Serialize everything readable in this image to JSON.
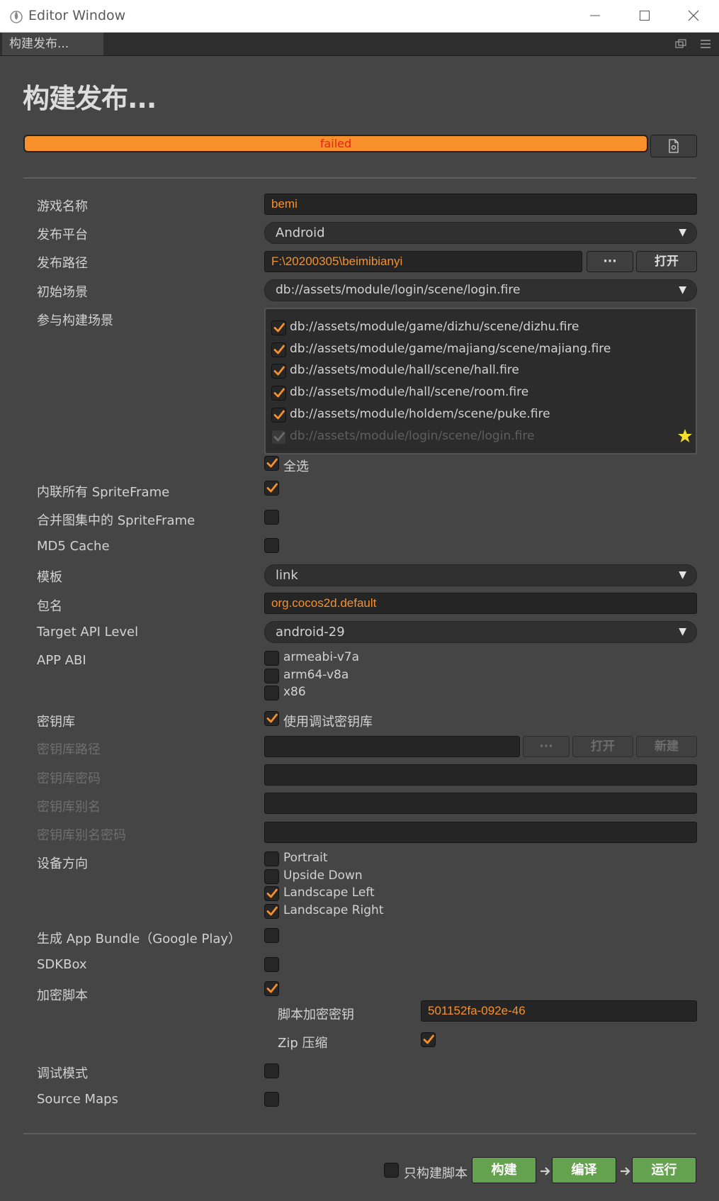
{
  "window": {
    "title": "Editor Window",
    "tab_label": "构建发布..."
  },
  "panel": {
    "heading": "构建发布...",
    "progress": {
      "value": 1.0,
      "status": "failed",
      "color": "#f7902b",
      "status_color": "#e8231f"
    }
  },
  "form": {
    "game_name": {
      "label": "游戏名称",
      "value": "bemi"
    },
    "platform": {
      "label": "发布平台",
      "value": "Android"
    },
    "build_path": {
      "label": "发布路径",
      "value": "F:\\20200305\\beimibianyi",
      "browse_label": "···",
      "open_label": "打开"
    },
    "start_scene": {
      "label": "初始场景",
      "value": "db://assets/module/login/scene/login.fire"
    },
    "scenes": {
      "label": "参与构建场景",
      "items": [
        {
          "path": "db://assets/module/game/dizhu/scene/dizhu.fire",
          "checked": true
        },
        {
          "path": "db://assets/module/game/majiang/scene/majiang.fire",
          "checked": true
        },
        {
          "path": "db://assets/module/hall/scene/hall.fire",
          "checked": true
        },
        {
          "path": "db://assets/module/hall/scene/room.fire",
          "checked": true
        },
        {
          "path": "db://assets/module/holdem/scene/puke.fire",
          "checked": true
        },
        {
          "path": "db://assets/module/login/scene/login.fire",
          "checked": true,
          "disabled": true,
          "start": true
        }
      ],
      "select_all_label": "全选",
      "select_all_checked": true
    },
    "inline_sprite_frames": {
      "label": "内联所有 SpriteFrame",
      "checked": true
    },
    "merge_sprite_frames": {
      "label": "合并图集中的 SpriteFrame",
      "checked": false
    },
    "md5_cache": {
      "label": "MD5 Cache",
      "checked": false
    },
    "template": {
      "label": "模板",
      "value": "link"
    },
    "package_name": {
      "label": "包名",
      "value": "org.cocos2d.default"
    },
    "target_api": {
      "label": "Target API Level",
      "value": "android-29"
    },
    "app_abi": {
      "label": "APP ABI",
      "options": [
        {
          "name": "armeabi-v7a",
          "checked": false
        },
        {
          "name": "arm64-v8a",
          "checked": false
        },
        {
          "name": "x86",
          "checked": false
        }
      ]
    },
    "keystore": {
      "label": "密钥库",
      "use_debug_label": "使用调试密钥库",
      "use_debug_checked": true,
      "path_label": "密钥库路径",
      "path_value": "",
      "browse_label": "···",
      "open_label": "打开",
      "new_label": "新建",
      "password_label": "密钥库密码",
      "alias_label": "密钥库别名",
      "alias_password_label": "密钥库别名密码"
    },
    "orientation": {
      "label": "设备方向",
      "options": [
        {
          "name": "Portrait",
          "checked": false
        },
        {
          "name": "Upside Down",
          "checked": false
        },
        {
          "name": "Landscape Left",
          "checked": true
        },
        {
          "name": "Landscape Right",
          "checked": true
        }
      ]
    },
    "app_bundle": {
      "label": "生成 App Bundle（Google Play）",
      "checked": false
    },
    "sdkbox": {
      "label": "SDKBox",
      "checked": false
    },
    "encrypt_js": {
      "label": "加密脚本",
      "checked": true,
      "key_label": "脚本加密密钥",
      "key_value": "501152fa-092e-46",
      "zip_label": "Zip 压缩",
      "zip_checked": true
    },
    "debug_mode": {
      "label": "调试模式",
      "checked": false
    },
    "source_maps": {
      "label": "Source Maps",
      "checked": false
    }
  },
  "footer": {
    "build_scripts_only_label": "只构建脚本",
    "build_scripts_only_checked": false,
    "build_label": "构建",
    "compile_label": "编译",
    "run_label": "运行"
  },
  "colors": {
    "accent": "#f7902b",
    "panel_bg": "#454545",
    "action_green": "#64a24f",
    "error_text": "#e8231f",
    "star": "#f4e02a"
  }
}
